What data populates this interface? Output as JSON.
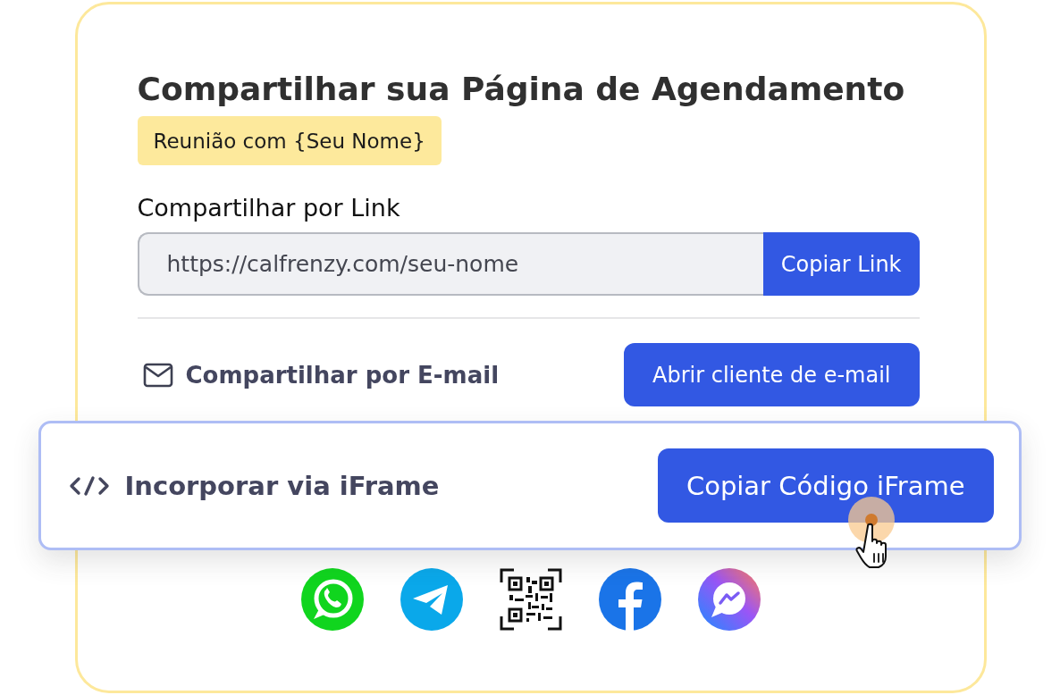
{
  "title": "Compartilhar sua Página de Agendamento",
  "meeting_badge": "Reunião com {Seu Nome}",
  "link_share": {
    "label": "Compartilhar por Link",
    "url": "https://calfrenzy.com/seu-nome",
    "button": "Copiar Link"
  },
  "email_share": {
    "label": "Compartilhar por E-mail",
    "button": "Abrir cliente de e-mail"
  },
  "iframe_embed": {
    "label": "Incorporar via iFrame",
    "button": "Copiar Código iFrame"
  }
}
